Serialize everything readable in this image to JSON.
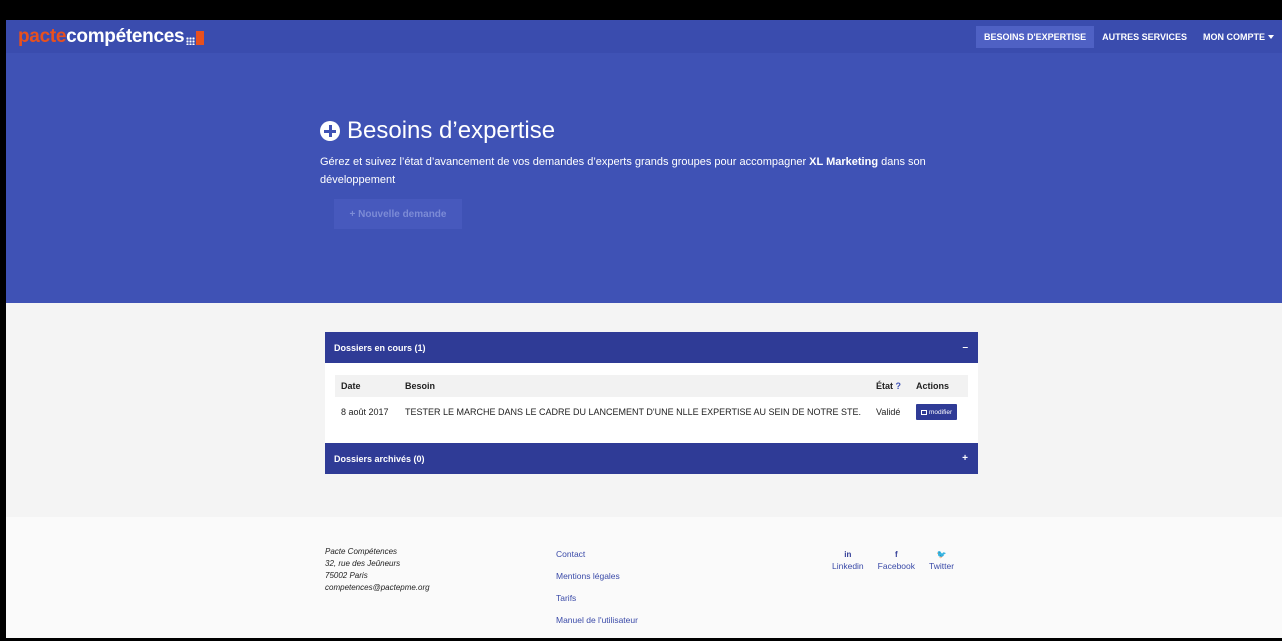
{
  "brand": {
    "part1": "pacte",
    "part2": "compétences"
  },
  "nav": {
    "items": [
      {
        "label": "BESOINS D'EXPERTISE",
        "active": true
      },
      {
        "label": "AUTRES SERVICES",
        "active": false
      },
      {
        "label": "MON COMPTE",
        "active": false
      }
    ]
  },
  "hero": {
    "title": "Besoins d’expertise",
    "desc_before": "Gérez et suivez l’état d’avancement de vos demandes d’experts grands groupes pour accompagner ",
    "desc_company": "XL Marketing",
    "desc_after": " dans son développement",
    "new_button": "+ Nouvelle demande"
  },
  "panels": {
    "current": {
      "title": "Dossiers en cours (1)",
      "toggle": "–",
      "columns": {
        "date": "Date",
        "besoin": "Besoin",
        "etat": "État",
        "etat_help": "?",
        "actions": "Actions"
      },
      "rows": [
        {
          "date": "8 août 2017",
          "besoin": "TESTER LE MARCHE DANS LE CADRE DU LANCEMENT D'UNE NLLE EXPERTISE AU SEIN DE NOTRE STE.",
          "etat": "Validé",
          "action": "modifier"
        }
      ]
    },
    "archived": {
      "title": "Dossiers archivés (0)",
      "toggle": "+"
    }
  },
  "footer": {
    "address": [
      "Pacte Compétences",
      "32, rue des Jeûneurs",
      "75002 Paris",
      "competences@pactepme.org"
    ],
    "links": [
      "Contact",
      "Mentions légales",
      "Tarifs",
      "Manuel de l'utilisateur"
    ],
    "social": [
      {
        "icon": "in",
        "label": "Linkedin"
      },
      {
        "icon": "f",
        "label": "Facebook"
      },
      {
        "icon": "🐦",
        "label": "Twitter"
      }
    ]
  },
  "colors": {
    "nav": "#3a4cae",
    "hero": "#3f52b5",
    "panel_header": "#2f3b96",
    "brand_orange": "#e8501e"
  }
}
